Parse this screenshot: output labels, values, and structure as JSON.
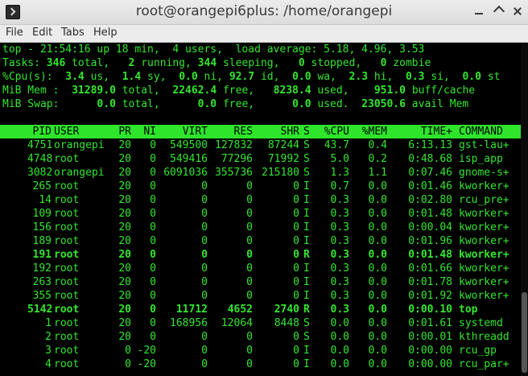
{
  "window": {
    "title": "root@orangepi6plus: /home/orangepi"
  },
  "menu": {
    "file": "File",
    "edit": "Edit",
    "tabs": "Tabs",
    "help": "Help"
  },
  "summary": {
    "line1": "top - 21:54:16 up 18 min,  4 users,  load average: 5.18, 4.96, 3.53",
    "tasks_label": "Tasks:",
    "tasks_total": "346",
    "tasks_running": "2",
    "tasks_sleeping": "344",
    "tasks_stopped": "0",
    "tasks_zombie": "0",
    "cpu_label": "%Cpu(s):",
    "cpu_us": "3.4",
    "cpu_sy": "1.4",
    "cpu_ni": "0.0",
    "cpu_id": "92.7",
    "cpu_wa": "0.0",
    "cpu_hi": "2.3",
    "cpu_si": "0.3",
    "cpu_st": "0.0",
    "mem_label": "MiB Mem :",
    "mem_total": "31289.0",
    "mem_free": "22462.4",
    "mem_used": "8238.4",
    "mem_buff": "951.0",
    "swap_label": "MiB Swap:",
    "swap_total": "0.0",
    "swap_free": "0.0",
    "swap_used": "0.0",
    "swap_avail": "23050.6"
  },
  "columns": [
    "PID",
    "USER",
    "PR",
    "NI",
    "VIRT",
    "RES",
    "SHR",
    "S",
    "%CPU",
    "%MEM",
    "TIME+",
    "COMMAND"
  ],
  "processes": [
    {
      "pid": "4751",
      "user": "orangepi",
      "pr": "20",
      "ni": "0",
      "virt": "549500",
      "res": "127832",
      "shr": "87244",
      "s": "S",
      "cpu": "43.7",
      "mem": "0.4",
      "time": "6:13.13",
      "cmd": "gst-lau+",
      "bold": false
    },
    {
      "pid": "4748",
      "user": "root",
      "pr": "20",
      "ni": "0",
      "virt": "549416",
      "res": "77296",
      "shr": "71992",
      "s": "S",
      "cpu": "5.0",
      "mem": "0.2",
      "time": "0:48.68",
      "cmd": "isp_app",
      "bold": false
    },
    {
      "pid": "3082",
      "user": "orangepi",
      "pr": "20",
      "ni": "0",
      "virt": "6091036",
      "res": "355736",
      "shr": "215180",
      "s": "S",
      "cpu": "1.3",
      "mem": "1.1",
      "time": "0:07.46",
      "cmd": "gnome-s+",
      "bold": false
    },
    {
      "pid": "265",
      "user": "root",
      "pr": "20",
      "ni": "0",
      "virt": "0",
      "res": "0",
      "shr": "0",
      "s": "I",
      "cpu": "0.7",
      "mem": "0.0",
      "time": "0:01.46",
      "cmd": "kworker+",
      "bold": false
    },
    {
      "pid": "14",
      "user": "root",
      "pr": "20",
      "ni": "0",
      "virt": "0",
      "res": "0",
      "shr": "0",
      "s": "I",
      "cpu": "0.3",
      "mem": "0.0",
      "time": "0:02.80",
      "cmd": "rcu_pre+",
      "bold": false
    },
    {
      "pid": "109",
      "user": "root",
      "pr": "20",
      "ni": "0",
      "virt": "0",
      "res": "0",
      "shr": "0",
      "s": "I",
      "cpu": "0.3",
      "mem": "0.0",
      "time": "0:01.48",
      "cmd": "kworker+",
      "bold": false
    },
    {
      "pid": "156",
      "user": "root",
      "pr": "20",
      "ni": "0",
      "virt": "0",
      "res": "0",
      "shr": "0",
      "s": "I",
      "cpu": "0.3",
      "mem": "0.0",
      "time": "0:00.04",
      "cmd": "kworker+",
      "bold": false
    },
    {
      "pid": "189",
      "user": "root",
      "pr": "20",
      "ni": "0",
      "virt": "0",
      "res": "0",
      "shr": "0",
      "s": "I",
      "cpu": "0.3",
      "mem": "0.0",
      "time": "0:01.96",
      "cmd": "kworker+",
      "bold": false
    },
    {
      "pid": "191",
      "user": "root",
      "pr": "20",
      "ni": "0",
      "virt": "0",
      "res": "0",
      "shr": "0",
      "s": "R",
      "cpu": "0.3",
      "mem": "0.0",
      "time": "0:01.48",
      "cmd": "kworker+",
      "bold": true
    },
    {
      "pid": "192",
      "user": "root",
      "pr": "20",
      "ni": "0",
      "virt": "0",
      "res": "0",
      "shr": "0",
      "s": "I",
      "cpu": "0.3",
      "mem": "0.0",
      "time": "0:01.66",
      "cmd": "kworker+",
      "bold": false
    },
    {
      "pid": "263",
      "user": "root",
      "pr": "20",
      "ni": "0",
      "virt": "0",
      "res": "0",
      "shr": "0",
      "s": "I",
      "cpu": "0.3",
      "mem": "0.0",
      "time": "0:01.78",
      "cmd": "kworker+",
      "bold": false
    },
    {
      "pid": "355",
      "user": "root",
      "pr": "20",
      "ni": "0",
      "virt": "0",
      "res": "0",
      "shr": "0",
      "s": "I",
      "cpu": "0.3",
      "mem": "0.0",
      "time": "0:01.92",
      "cmd": "kworker+",
      "bold": false
    },
    {
      "pid": "5142",
      "user": "root",
      "pr": "20",
      "ni": "0",
      "virt": "11712",
      "res": "4652",
      "shr": "2740",
      "s": "R",
      "cpu": "0.3",
      "mem": "0.0",
      "time": "0:00.10",
      "cmd": "top",
      "bold": true
    },
    {
      "pid": "1",
      "user": "root",
      "pr": "20",
      "ni": "0",
      "virt": "168956",
      "res": "12064",
      "shr": "8448",
      "s": "S",
      "cpu": "0.0",
      "mem": "0.0",
      "time": "0:01.61",
      "cmd": "systemd",
      "bold": false
    },
    {
      "pid": "2",
      "user": "root",
      "pr": "20",
      "ni": "0",
      "virt": "0",
      "res": "0",
      "shr": "0",
      "s": "S",
      "cpu": "0.0",
      "mem": "0.0",
      "time": "0:00.01",
      "cmd": "kthreadd",
      "bold": false
    },
    {
      "pid": "3",
      "user": "root",
      "pr": "0",
      "ni": "-20",
      "virt": "0",
      "res": "0",
      "shr": "0",
      "s": "I",
      "cpu": "0.0",
      "mem": "0.0",
      "time": "0:00.00",
      "cmd": "rcu_gp",
      "bold": false
    },
    {
      "pid": "4",
      "user": "root",
      "pr": "0",
      "ni": "-20",
      "virt": "0",
      "res": "0",
      "shr": "0",
      "s": "I",
      "cpu": "0.0",
      "mem": "0.0",
      "time": "0:00.00",
      "cmd": "rcu_par+",
      "bold": false
    }
  ],
  "colors": {
    "terminal_fg": "#33e62e",
    "terminal_bg": "#000000",
    "header_bg": "#2ee52b"
  },
  "icons": {
    "app": "terminal-icon",
    "minimize": "minimize-icon",
    "maximize": "maximize-icon",
    "close": "close-icon"
  }
}
